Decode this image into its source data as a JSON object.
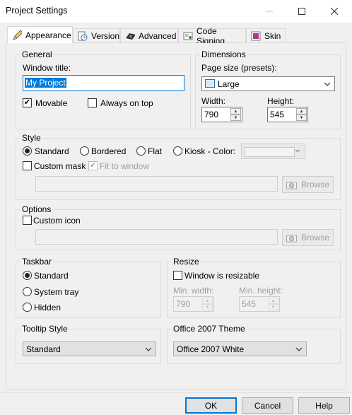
{
  "window": {
    "title": "Project Settings"
  },
  "tabs": [
    {
      "label": "Appearance",
      "icon": "pencil-icon"
    },
    {
      "label": "Version",
      "icon": "clock-document-icon"
    },
    {
      "label": "Advanced",
      "icon": "gear-icon"
    },
    {
      "label": "Code Signing",
      "icon": "certificate-icon"
    },
    {
      "label": "Skin",
      "icon": "skin-palette-icon"
    }
  ],
  "general": {
    "legend": "General",
    "window_title_label": "Window title:",
    "window_title_value": "My Project",
    "movable_label": "Movable",
    "movable_checked": true,
    "always_on_top_label": "Always on top",
    "always_on_top_checked": false
  },
  "dimensions": {
    "legend": "Dimensions",
    "page_size_label": "Page size (presets):",
    "page_size_value": "Large",
    "width_label": "Width:",
    "width_value": "790",
    "height_label": "Height:",
    "height_value": "545"
  },
  "style": {
    "legend": "Style",
    "options": [
      "Standard",
      "Bordered",
      "Flat",
      "Kiosk - Color:"
    ],
    "selected": "Standard",
    "custom_mask_label": "Custom mask",
    "fit_to_window_label": "Fit to window",
    "fit_to_window_checked": true,
    "browse_label": "Browse"
  },
  "options": {
    "legend": "Options",
    "custom_icon_label": "Custom icon",
    "browse_label": "Browse"
  },
  "taskbar": {
    "legend": "Taskbar",
    "options": [
      "Standard",
      "System tray",
      "Hidden"
    ],
    "selected": "Standard"
  },
  "resize": {
    "legend": "Resize",
    "resizable_label": "Window is resizable",
    "min_width_label": "Min. width:",
    "min_width_value": "790",
    "min_height_label": "Min. height:",
    "min_height_value": "545"
  },
  "tooltip_style": {
    "legend": "Tooltip Style",
    "value": "Standard"
  },
  "office_theme": {
    "legend": "Office 2007 Theme",
    "value": "Office 2007 White"
  },
  "buttons": {
    "ok": "OK",
    "cancel": "Cancel",
    "help": "Help"
  },
  "colors": {
    "accent": "#0078d7",
    "background": "#f0f0f0"
  }
}
